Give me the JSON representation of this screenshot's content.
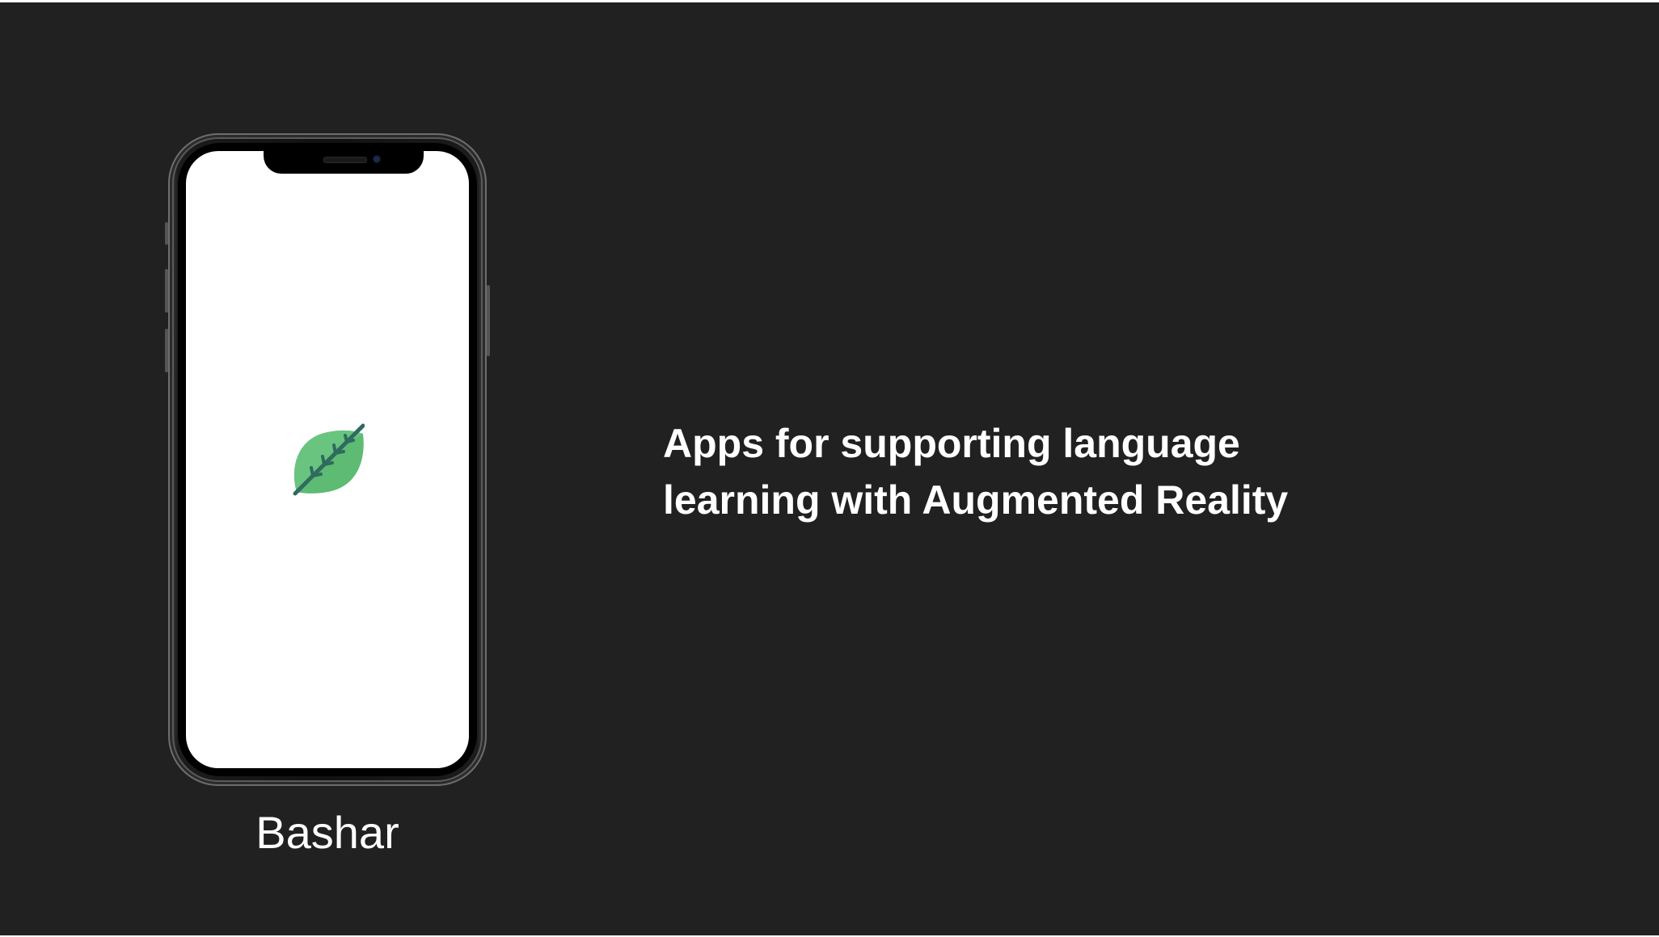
{
  "slide": {
    "background": "#212121",
    "headline": {
      "line1": "Apps for supporting language",
      "line2": "learning with Augmented Reality"
    },
    "device_label": "Bashar"
  },
  "phone": {
    "screen_color": "#ffffff",
    "app_icon": "leaf-icon",
    "app_icon_colors": {
      "leaf": "#5dbb73",
      "vein": "#2f6b5e"
    }
  }
}
